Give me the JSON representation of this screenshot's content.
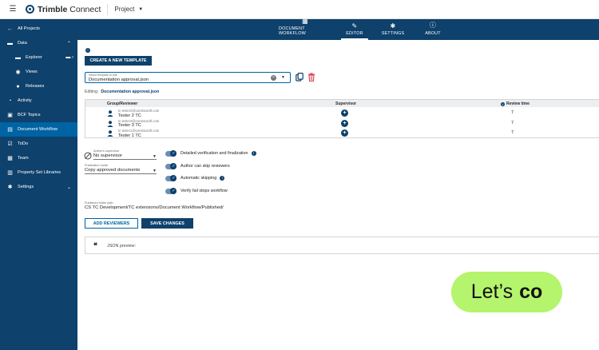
{
  "app": {
    "brand_strong": "Trimble",
    "brand_light": "Connect",
    "project_label": "Project"
  },
  "sidebar": {
    "items": [
      {
        "label": "All Projects",
        "icon": "arrow-left-icon"
      },
      {
        "label": "Data",
        "icon": "folder-icon"
      },
      {
        "label": "Explorer",
        "icon": "folder-icon"
      },
      {
        "label": "Views",
        "icon": "views-icon"
      },
      {
        "label": "Releases",
        "icon": "releases-icon"
      },
      {
        "label": "Activity",
        "icon": "activity-icon"
      },
      {
        "label": "BCF Topics",
        "icon": "bcf-icon"
      },
      {
        "label": "Document Workflow",
        "icon": "workflow-icon"
      },
      {
        "label": "ToDo",
        "icon": "todo-icon"
      },
      {
        "label": "Team",
        "icon": "team-icon"
      },
      {
        "label": "Property Set Libraries",
        "icon": "library-icon"
      },
      {
        "label": "Settings",
        "icon": "gear-icon"
      }
    ]
  },
  "nav": {
    "tabs": [
      {
        "label": "DOCUMENT WORKFLOW",
        "icon": "workflow-icon"
      },
      {
        "label": "EDITOR",
        "icon": "pencil-icon"
      },
      {
        "label": "SETTINGS",
        "icon": "gear-icon"
      },
      {
        "label": "ABOUT",
        "icon": "info-icon"
      }
    ],
    "active_tab": "EDITOR"
  },
  "editor": {
    "create_button": "CREATE A NEW TEMPLATE",
    "select_label": "Select template to edit",
    "select_value": "Documentation approval.json",
    "editing_label": "Editing:",
    "editing_value": "Documentation approval.json"
  },
  "table": {
    "headers": {
      "reviewer": "Group/Reviewer",
      "supervisor": "Supervisor",
      "review_time": "Review time"
    },
    "rows": [
      {
        "email": "tc-tester2@construsoft.com",
        "name": "Tester 2 TC",
        "review_time": "7"
      },
      {
        "email": "tc-tester3@construsoft.com",
        "name": "Tester 3 TC",
        "review_time": "7"
      },
      {
        "email": "tc-tester1@construsoft.com",
        "name": "Tester 1 TC",
        "review_time": "7"
      }
    ]
  },
  "options": {
    "supervisor_label": "Author's supervisor",
    "supervisor_value": "No supervisor",
    "publication_label": "Publication mode",
    "publication_value": "Copy approved documents",
    "toggles": [
      {
        "label": "Detailed verification and finalization",
        "enabled": true,
        "info": true
      },
      {
        "label": "Author can skip reviewers",
        "enabled": true,
        "info": false
      },
      {
        "label": "Automatic skipping",
        "enabled": true,
        "info": true
      },
      {
        "label": "Verify fail stops workflow",
        "enabled": true,
        "info": false
      }
    ]
  },
  "folder": {
    "label": "Published folder path",
    "value": "CS TC Development/TC extensions/Document Workflow/Published/"
  },
  "actions": {
    "add_reviewers": "ADD REVIEWERS",
    "save": "SAVE CHANGES"
  },
  "json_preview": {
    "label": "JSON preview:"
  },
  "cta": {
    "text_light": "Let’s",
    "text_bold": "co"
  },
  "colors": {
    "primary": "#0e416c",
    "accent": "#0063a3",
    "active": "#0063a3",
    "cta": "#b5f46d",
    "danger": "#d9434e"
  }
}
